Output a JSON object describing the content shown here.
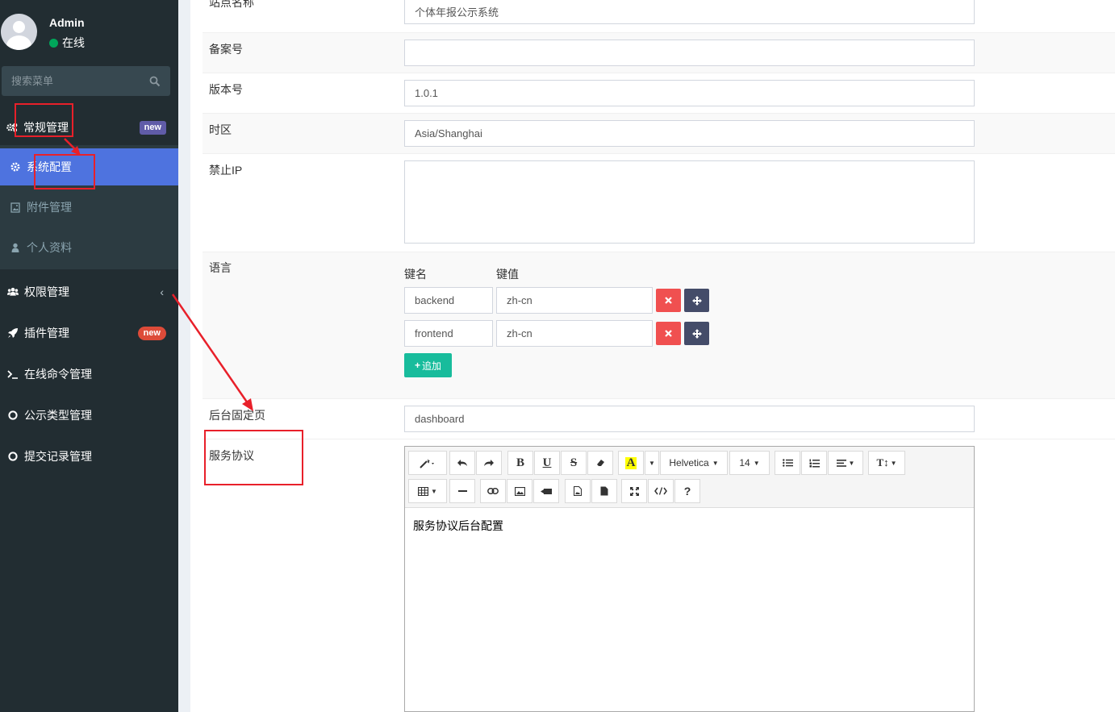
{
  "user": {
    "name": "Admin",
    "status": "在线"
  },
  "search": {
    "placeholder": "搜索菜单"
  },
  "sidebar": {
    "group_general": {
      "label": "常规管理",
      "badge": "new"
    },
    "sub_items": [
      {
        "label": "系统配置",
        "icon": "gear-icon",
        "active": true
      },
      {
        "label": "附件管理",
        "icon": "image-icon",
        "active": false
      },
      {
        "label": "个人资料",
        "icon": "user-icon",
        "active": false
      }
    ],
    "items": [
      {
        "label": "权限管理",
        "icon": "users-icon"
      },
      {
        "label": "插件管理",
        "icon": "rocket-icon",
        "badge": "new"
      },
      {
        "label": "在线命令管理",
        "icon": "terminal-icon"
      },
      {
        "label": "公示类型管理",
        "icon": "circle-icon"
      },
      {
        "label": "提交记录管理",
        "icon": "circle-icon"
      }
    ]
  },
  "form": {
    "site_name": {
      "label": "站点名称",
      "value": "个体年报公示系统"
    },
    "beian": {
      "label": "备案号",
      "value": ""
    },
    "version": {
      "label": "版本号",
      "value": "1.0.1"
    },
    "timezone": {
      "label": "时区",
      "value": "Asia/Shanghai"
    },
    "forbidden_ip": {
      "label": "禁止IP",
      "value": ""
    },
    "language": {
      "label": "语言",
      "key_header": "键名",
      "value_header": "键值",
      "rows": [
        {
          "key": "backend",
          "value": "zh-cn"
        },
        {
          "key": "frontend",
          "value": "zh-cn"
        }
      ],
      "add_label": "追加"
    },
    "fixed_page": {
      "label": "后台固定页",
      "value": "dashboard"
    },
    "agreement": {
      "label": "服务协议",
      "content": "服务协议后台配置"
    }
  },
  "editor_toolbar": {
    "font_name": "Helvetica",
    "font_size": "14",
    "bold": "B",
    "underline": "U",
    "strike": "S",
    "color": "A",
    "help": "?"
  },
  "colors": {
    "sidebar_bg": "#222d32",
    "active_bg": "#4e73df",
    "success": "#18bc9c",
    "danger": "#f05050",
    "annotation": "#e8202a"
  }
}
